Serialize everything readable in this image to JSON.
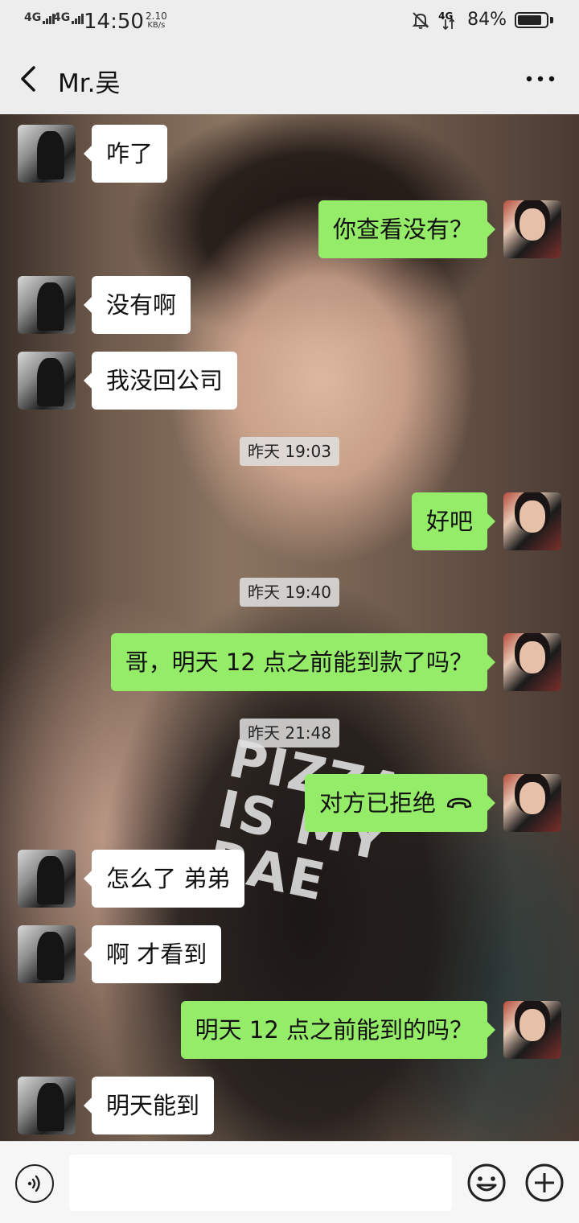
{
  "status_bar": {
    "signal1": "4G",
    "signal2": "4G",
    "time": "14:50",
    "speed_value": "2.10",
    "speed_unit": "KB/s",
    "network_small": "4G",
    "battery_percent_text": "84%",
    "battery_level": 0.84,
    "icons": [
      "signal-icon",
      "mute-bell-icon",
      "network-4g-icon",
      "battery-icon"
    ]
  },
  "header": {
    "title": "Mr.吴",
    "back_icon": "chevron-left-icon",
    "more_icon": "more-dots-icon"
  },
  "messages": [
    {
      "from": "them",
      "text": "咋了"
    },
    {
      "from": "me",
      "text": "你查看没有？"
    },
    {
      "from": "them",
      "text": "没有啊"
    },
    {
      "from": "them",
      "text": "我没回公司"
    },
    {
      "timestamp": "昨天 19:03"
    },
    {
      "from": "me",
      "text": "好吧"
    },
    {
      "timestamp": "昨天 19:40"
    },
    {
      "from": "me",
      "text": "哥，明天 12 点之前能到款了吗？"
    },
    {
      "timestamp": "昨天 21:48"
    },
    {
      "from": "me",
      "text": "对方已拒绝",
      "icon": "hangup-phone-icon"
    },
    {
      "from": "them",
      "text": "怎么了 弟弟"
    },
    {
      "from": "them",
      "text": "啊  才看到"
    },
    {
      "from": "me",
      "text": "明天 12 点之前能到的吗？"
    },
    {
      "from": "them",
      "text": "明天能到"
    }
  ],
  "background": {
    "shirt_text": "PIZZA IS MY BAE"
  },
  "input_bar": {
    "placeholder": "",
    "value": "",
    "voice_icon": "voice-icon",
    "emoji_icon": "emoji-icon",
    "plus_icon": "plus-icon"
  },
  "colors": {
    "my_bubble": "#95ec69",
    "their_bubble": "#ffffff",
    "bar_background": "#ededed"
  }
}
